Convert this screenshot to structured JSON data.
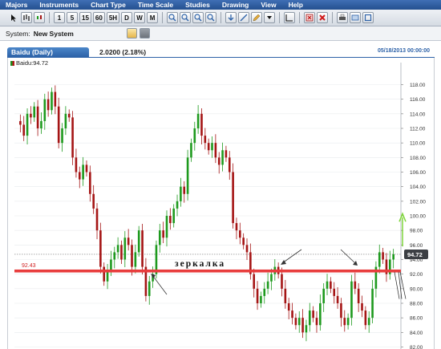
{
  "menu": [
    "Majors",
    "Instruments",
    "Chart Type",
    "Time Scale",
    "Studies",
    "Drawing",
    "View",
    "Help"
  ],
  "toolbar": {
    "timeframes": [
      "1",
      "5",
      "15",
      "60",
      "5H",
      "D",
      "W",
      "M"
    ]
  },
  "system": {
    "label": "System:",
    "value": "New System"
  },
  "chart": {
    "tab_label": "Baidu (Daily)",
    "change": "2.0200 (2.18%)",
    "date": "05/18/2013 00:00:00",
    "legend": "Baidu:94.72",
    "price_badge": "94.72",
    "level_label": "92.43",
    "annotation": "зеркалка",
    "colors": {
      "up": "#1e9a1e",
      "down": "#a51515",
      "level": "#e83c3c",
      "green_arrow": "#7fd63a"
    }
  },
  "chart_data": {
    "type": "candlestick",
    "y_ticks": [
      "118.00",
      "116.00",
      "114.00",
      "112.00",
      "110.00",
      "108.00",
      "106.00",
      "104.00",
      "102.00",
      "100.00",
      "98.00",
      "96.00",
      "94.00",
      "92.00",
      "90.00",
      "88.00",
      "86.00",
      "84.00",
      "82.00"
    ],
    "ylim": [
      82,
      118.5
    ],
    "support_level": 92.43,
    "last_price": 94.72,
    "close_path": [
      113,
      112.5,
      111,
      114,
      113.5,
      115,
      112,
      113,
      116,
      114.5,
      117,
      115,
      110,
      112,
      114,
      113.5,
      108,
      106,
      105,
      107,
      106,
      103,
      101,
      98,
      93,
      91,
      92.5,
      94,
      95,
      96,
      94,
      97,
      96,
      93,
      95,
      98,
      93,
      89,
      91,
      92,
      96,
      98,
      97,
      100,
      99,
      101,
      102,
      104,
      103,
      108,
      110,
      112,
      114,
      111,
      110,
      109,
      110,
      108,
      107,
      109,
      108,
      106,
      99,
      98,
      97,
      96,
      95,
      92,
      90,
      88,
      89,
      90,
      91,
      92,
      93,
      92,
      90,
      88,
      87,
      86,
      85,
      86,
      84,
      85,
      87,
      86,
      85,
      88,
      90,
      91,
      90,
      89,
      88,
      86,
      85,
      86,
      91,
      90,
      88,
      87,
      85,
      86,
      90,
      93,
      95,
      94,
      92,
      94,
      94.72
    ]
  }
}
